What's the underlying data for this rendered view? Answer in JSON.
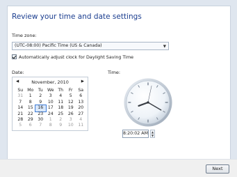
{
  "wizard": {
    "heading": "Review your time and date settings",
    "timezone_label": "Time zone:",
    "timezone_value": "(UTC-08:00) Pacific Time (US & Canada)",
    "dst_checkbox_label": "Automatically adjust clock for Daylight Saving Time",
    "dst_checked": true,
    "date_label": "Date:",
    "time_label": "Time:",
    "next_label": "Next"
  },
  "calendar": {
    "month_title": "November, 2010",
    "weekdays": [
      "Su",
      "Mo",
      "Tu",
      "We",
      "Th",
      "Fr",
      "Sa"
    ],
    "weeks": [
      [
        "31",
        "1",
        "2",
        "3",
        "4",
        "5",
        "6"
      ],
      [
        "7",
        "8",
        "9",
        "10",
        "11",
        "12",
        "13"
      ],
      [
        "14",
        "15",
        "16",
        "17",
        "18",
        "19",
        "20"
      ],
      [
        "21",
        "22",
        "23",
        "24",
        "25",
        "26",
        "27"
      ],
      [
        "28",
        "29",
        "30",
        "1",
        "2",
        "3",
        "4"
      ],
      [
        "5",
        "6",
        "7",
        "8",
        "9",
        "10",
        "11"
      ]
    ],
    "selected_day": "16"
  },
  "clock": {
    "time_value": "8:20:02 AM",
    "hour": 8,
    "minute": 20,
    "second": 2
  },
  "colors": {
    "heading": "#1a3d8f",
    "selection_outline": "#3d7bd6"
  },
  "icons": {
    "prev_month": "chevron-left-icon",
    "next_month": "chevron-right-icon",
    "dropdown": "chevron-down-icon"
  }
}
